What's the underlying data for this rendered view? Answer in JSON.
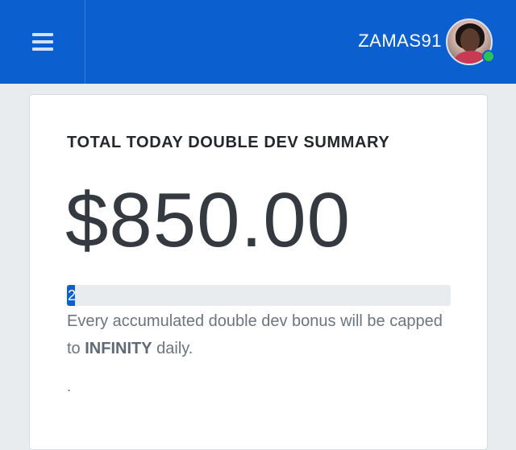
{
  "header": {
    "username": "ZAMAS91",
    "accent_color": "#0b5fcf",
    "menu_icon": "hamburger-menu-icon",
    "status": "online"
  },
  "card": {
    "title": "TOTAL TODAY DOUBLE DEV SUMMARY",
    "amount": "$850.00",
    "progress": {
      "value_label": "2",
      "percent": 2
    },
    "note_prefix": "Every accumulated double dev bonus will be capped to ",
    "note_highlight": "INFINITY",
    "note_suffix": " daily.",
    "trailing_mark": "."
  }
}
